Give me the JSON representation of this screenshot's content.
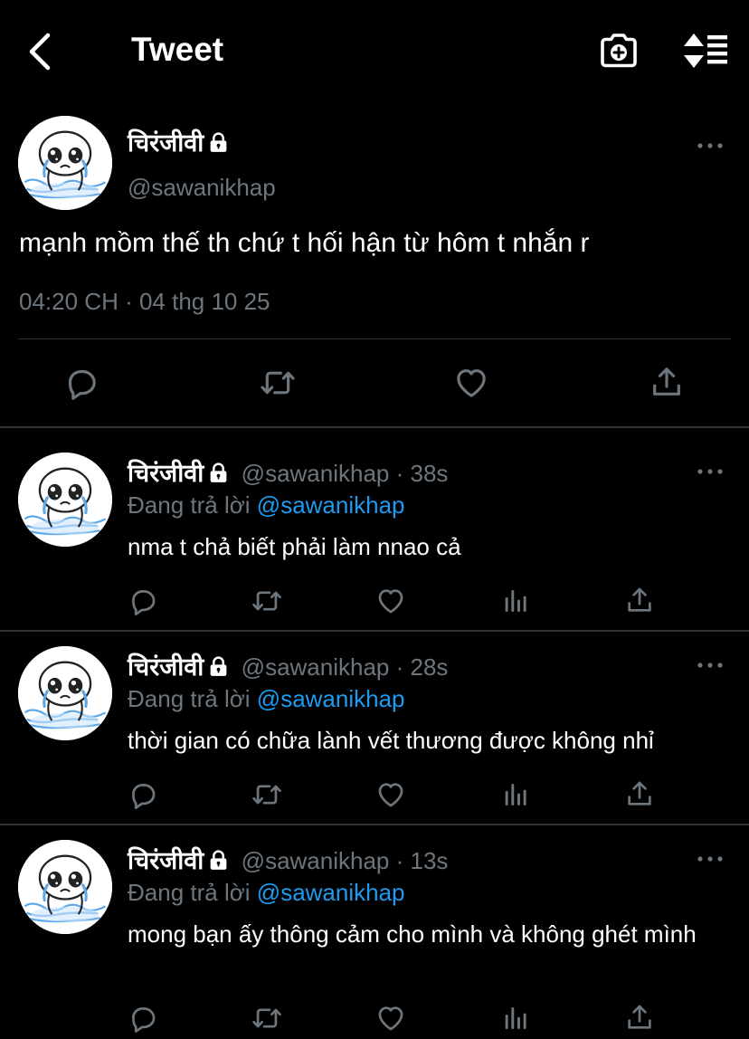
{
  "header": {
    "title": "Tweet"
  },
  "main_tweet": {
    "author": "चिरंजीवी",
    "handle": "@sawanikhap",
    "text": "mạnh mồm thế th chứ t hối hận từ hôm t nhắn r",
    "timestamp": "04:20 CH · 04 thg 10 25"
  },
  "replies": [
    {
      "author": "चिरंजीवी",
      "handle_time": "@sawanikhap · 38s",
      "replying_label": "Đang trả lời",
      "replying_to": "@sawanikhap",
      "text": "nma t chả biết phải làm nnao cả"
    },
    {
      "author": "चिरंजीवी",
      "handle_time": "@sawanikhap · 28s",
      "replying_label": "Đang trả lời",
      "replying_to": "@sawanikhap",
      "text": "thời gian có chữa lành vết thương được không nhỉ"
    },
    {
      "author": "चिरंजीवी",
      "handle_time": "@sawanikhap · 13s",
      "replying_label": "Đang trả lời",
      "replying_to": "@sawanikhap",
      "text": "mong bạn ấy thông cảm cho mình và không ghét mình"
    }
  ],
  "icons": {
    "back": "chevron-left-icon",
    "camera": "camera-add-icon",
    "sort": "sort-icon",
    "more": "more-icon",
    "lock": "lock-icon",
    "reply": "reply-icon",
    "retweet": "retweet-icon",
    "like": "like-icon",
    "views": "views-icon",
    "share": "share-icon"
  },
  "colors": {
    "background": "#000000",
    "text": "#e7e9ea",
    "secondary": "#6e767d",
    "link": "#1d9bf0",
    "divider": "#2f3336"
  }
}
